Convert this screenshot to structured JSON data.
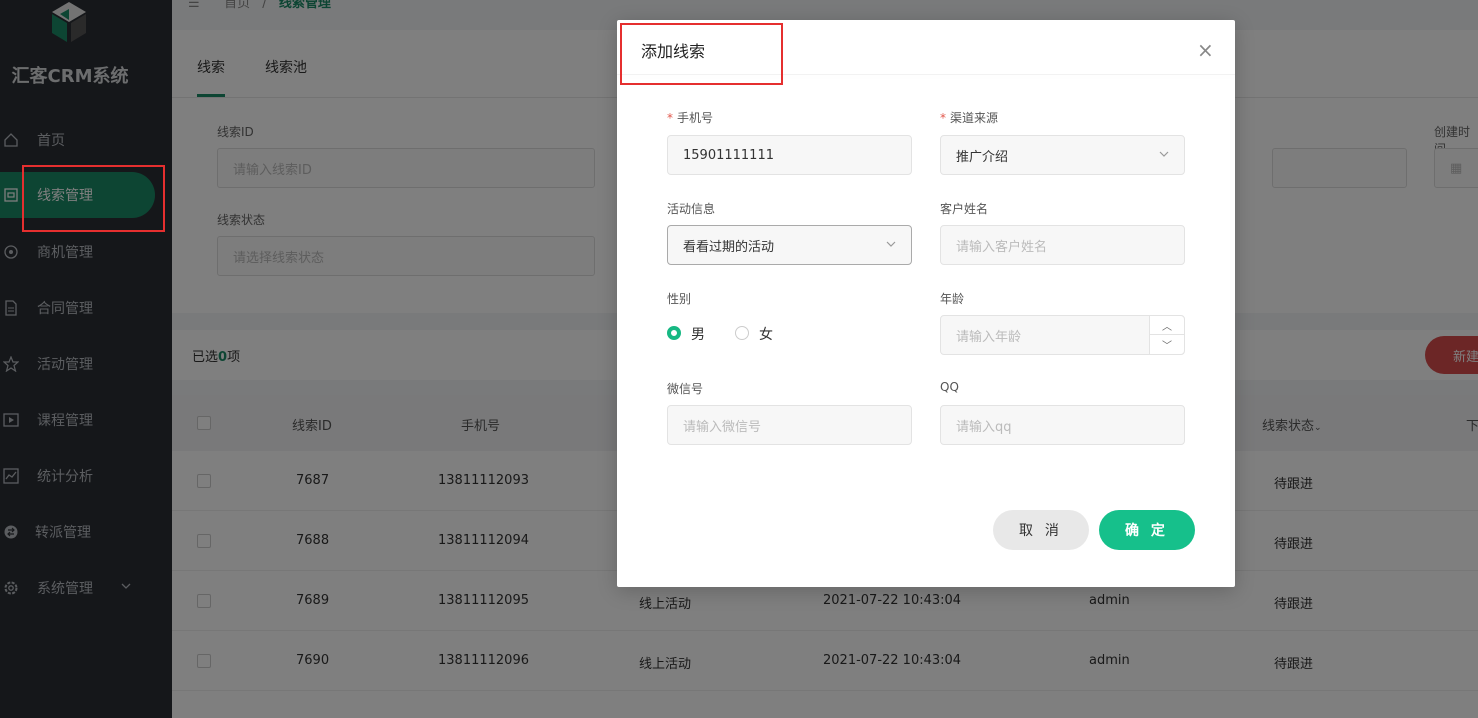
{
  "sidebar": {
    "brand": "汇客CRM系统",
    "items": [
      {
        "label": "首页",
        "icon": "home-icon"
      },
      {
        "label": "线索管理",
        "icon": "clue-icon"
      },
      {
        "label": "商机管理",
        "icon": "target-icon"
      },
      {
        "label": "合同管理",
        "icon": "document-icon"
      },
      {
        "label": "活动管理",
        "icon": "star-icon"
      },
      {
        "label": "课程管理",
        "icon": "video-icon"
      },
      {
        "label": "统计分析",
        "icon": "chart-icon"
      },
      {
        "label": "转派管理",
        "icon": "transfer-icon"
      },
      {
        "label": "系统管理",
        "icon": "gear-icon"
      }
    ]
  },
  "breadcrumb": {
    "home": "首页",
    "sep": "/",
    "current": "线索管理"
  },
  "tabs": [
    "线索",
    "线索池"
  ],
  "filters": {
    "clue_id_label": "线索ID",
    "clue_id_placeholder": "请输入线索ID",
    "status_label": "线索状态",
    "status_placeholder": "请选择线索状态",
    "created_label": "创建时间"
  },
  "selection": {
    "prefix": "已选",
    "count": "0",
    "suffix": "项"
  },
  "new_button": "新建",
  "table": {
    "headers": [
      "线索ID",
      "手机号",
      "线索状态",
      "下"
    ],
    "rows": [
      {
        "id": "7687",
        "phone": "13811112093",
        "activity": "",
        "time": "",
        "owner": "",
        "status": "待跟进"
      },
      {
        "id": "7688",
        "phone": "13811112094",
        "activity": "",
        "time": "",
        "owner": "",
        "status": "待跟进"
      },
      {
        "id": "7689",
        "phone": "13811112095",
        "activity": "线上活动",
        "time": "2021-07-22 10:43:04",
        "owner": "admin",
        "status": "待跟进"
      },
      {
        "id": "7690",
        "phone": "13811112096",
        "activity": "线上活动",
        "time": "2021-07-22 10:43:04",
        "owner": "admin",
        "status": "待跟进"
      }
    ]
  },
  "modal": {
    "title": "添加线索",
    "close": "×",
    "phone_label": "手机号",
    "phone_value": "15901111111",
    "channel_label": "渠道来源",
    "channel_value": "推广介绍",
    "activity_label": "活动信息",
    "activity_value": "看看过期的活动",
    "name_label": "客户姓名",
    "name_placeholder": "请输入客户姓名",
    "gender_label": "性别",
    "gender_male": "男",
    "gender_female": "女",
    "age_label": "年龄",
    "age_placeholder": "请输入年龄",
    "wechat_label": "微信号",
    "wechat_placeholder": "请输入微信号",
    "qq_label": "QQ",
    "qq_placeholder": "请输入qq",
    "cancel": "取 消",
    "confirm": "确 定"
  },
  "colors": {
    "accent": "#16c08b",
    "annotation": "#e52f2f",
    "sidebar": "#2b2f35"
  }
}
